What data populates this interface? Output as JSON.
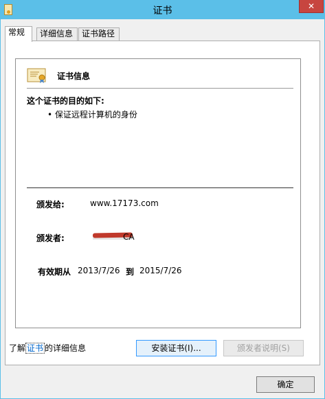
{
  "window": {
    "title": "证书",
    "close_glyph": "✕"
  },
  "tabs": [
    {
      "label": "常规",
      "active": true
    },
    {
      "label": "详细信息",
      "active": false
    },
    {
      "label": "证书路径",
      "active": false
    }
  ],
  "cert": {
    "header": "证书信息",
    "purpose_title": "这个证书的目的如下:",
    "purposes": [
      "• 保证远程计算机的身份"
    ],
    "issued_to_label": "颁发给:",
    "issued_to_value": "www.17173.com",
    "issued_by_label": "颁发者:",
    "issued_by_value": "CA",
    "validity_label": "有效期从",
    "valid_from": "2013/7/26",
    "to_label": "到",
    "valid_to": "2015/7/26"
  },
  "buttons": {
    "install": "安装证书(I)...",
    "issuer_statement": "颁发者说明(S)",
    "ok": "确定"
  },
  "learn_more": {
    "prefix": "了解",
    "link": "证书",
    "suffix": "的详细信息"
  },
  "colors": {
    "titlebar": "#5bbfe8",
    "close": "#c7453f",
    "redaction": "#c0392b"
  }
}
